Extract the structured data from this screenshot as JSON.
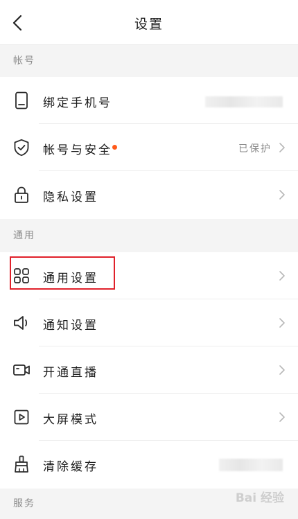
{
  "nav": {
    "title": "设置",
    "back_icon": "chevron-left-icon"
  },
  "sections": {
    "account": "帐号",
    "general": "通用",
    "service": "服务"
  },
  "rows": {
    "bind_phone": {
      "label": "绑定手机号",
      "icon": "phone-icon"
    },
    "account_security": {
      "label": "帐号与安全",
      "value": "已保护",
      "icon": "shield-check-icon"
    },
    "privacy": {
      "label": "隐私设置",
      "icon": "lock-icon"
    },
    "general_settings": {
      "label": "通用设置",
      "icon": "grid-icon"
    },
    "notification": {
      "label": "通知设置",
      "icon": "speaker-icon"
    },
    "live": {
      "label": "开通直播",
      "icon": "video-camera-icon"
    },
    "big_screen": {
      "label": "大屏模式",
      "icon": "play-screen-icon"
    },
    "clear_cache": {
      "label": "清除缓存",
      "icon": "broom-icon"
    }
  },
  "colors": {
    "highlight_border": "#e0202a",
    "badge_dot": "#ff5a1a",
    "page_background": "#f4f4f4"
  },
  "watermark": {
    "text": "Bai 经验"
  }
}
